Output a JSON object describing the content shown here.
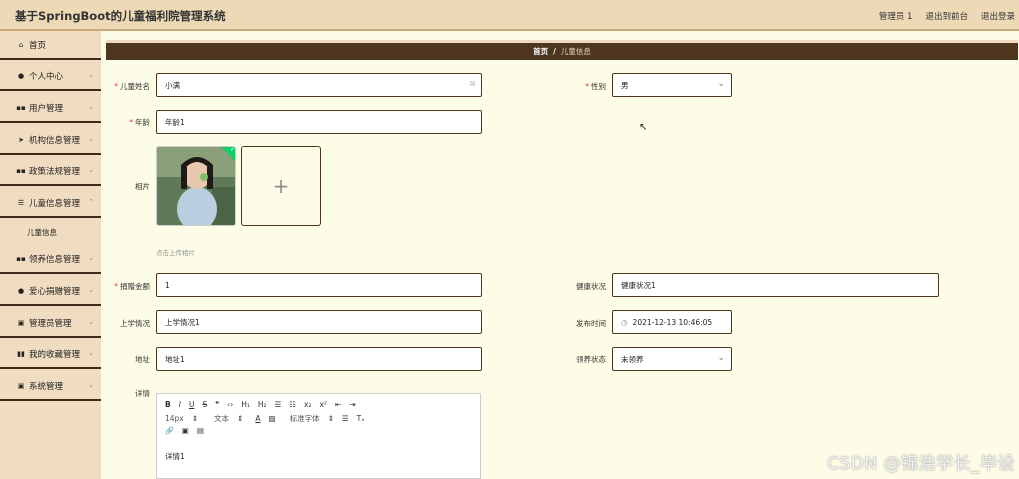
{
  "header": {
    "title": "基于SpringBoot的儿童福利院管理系统",
    "nav": [
      "管理员 1",
      "退出到前台",
      "退出登录"
    ]
  },
  "sidebar": {
    "items": [
      {
        "label": "首页",
        "icon": "home-icon"
      },
      {
        "label": "个人中心",
        "icon": "user-icon"
      },
      {
        "label": "用户管理",
        "icon": "grid-icon"
      },
      {
        "label": "机构信息管理",
        "icon": "send-icon"
      },
      {
        "label": "政策法规管理",
        "icon": "grid-icon"
      },
      {
        "label": "儿童信息管理",
        "icon": "list-icon"
      },
      {
        "label": "领养信息管理",
        "icon": "grid-icon"
      },
      {
        "label": "爱心捐赠管理",
        "icon": "user-icon"
      },
      {
        "label": "管理员管理",
        "icon": "doc-icon"
      },
      {
        "label": "我的收藏管理",
        "icon": "chart-icon"
      },
      {
        "label": "系统管理",
        "icon": "doc-icon"
      }
    ],
    "subitem": "儿童信息"
  },
  "breadcrumb": {
    "home": "首页",
    "sep": "/",
    "current": "儿童信息"
  },
  "form": {
    "name_label": "儿童姓名",
    "name_value": "小满",
    "gender_label": "性别",
    "gender_value": "男",
    "age_label": "年龄",
    "age_value": "年龄1",
    "photo_label": "相片",
    "upload_hint": "点击上传相片",
    "upload_plus": "+",
    "amount_label": "捐赠金额",
    "amount_value": "1",
    "health_label": "健康状况",
    "health_value": "健康状况1",
    "school_label": "上学情况",
    "school_value": "上学情况1",
    "publish_label": "发布时间",
    "publish_value": "2021-12-13 10:46:05",
    "address_label": "地址",
    "address_value": "地址1",
    "adopt_label": "领养状态",
    "adopt_value": "未领养",
    "detail_label": "详情",
    "required_mark": "*"
  },
  "editor": {
    "row1": [
      "B",
      "I",
      "U",
      "S",
      "❞",
      "‹›",
      "H₁",
      "H₂",
      "☰",
      "☷",
      "x₂",
      "x²",
      "⇤",
      "⇥"
    ],
    "row2": [
      "14px",
      "⇕",
      "文本",
      "⇕",
      "A",
      "▨",
      "标准字体",
      "⇕",
      "☰",
      "Tₓ"
    ],
    "row3": [
      "🔗",
      "▣",
      "▤"
    ],
    "content": "详情1"
  },
  "watermark": "CSDN @锦浩学长_毕设",
  "colors": {
    "accent": "#4e361f",
    "sidebar": "#f0dcc0",
    "header": "#edd9b6",
    "content": "#fdfce6"
  }
}
